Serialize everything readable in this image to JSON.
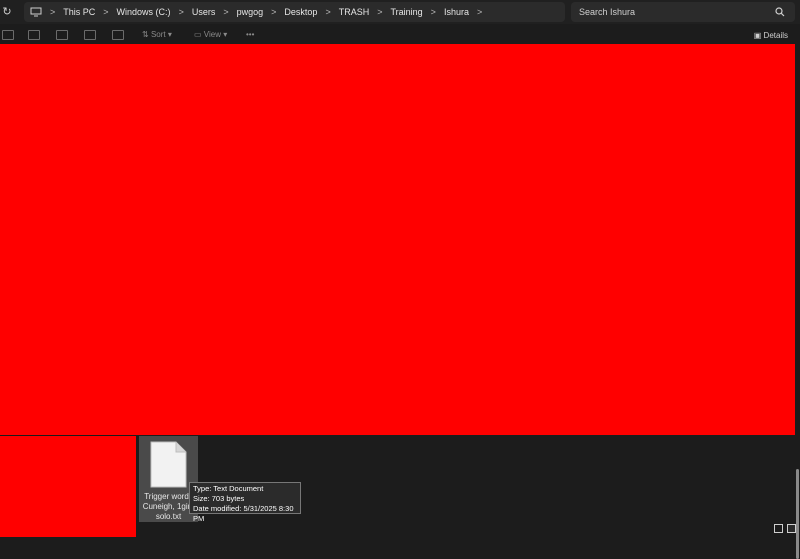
{
  "address_bar": {
    "refresh_icon": "refresh-icon",
    "crumbs": [
      "This PC",
      "Windows (C:)",
      "Users",
      "pwgog",
      "Desktop",
      "TRASH",
      "Training",
      "Ishura"
    ]
  },
  "search": {
    "placeholder": "Search Ishura",
    "icon": "search-icon"
  },
  "toolbar": {
    "sort_label": "Sort",
    "view_label": "View",
    "more_label": "•••",
    "details_label": "Details"
  },
  "file": {
    "name_line1": "Trigger words",
    "name_line2": "Cuneigh, 1girl,",
    "name_line3": "solo.txt"
  },
  "tooltip": {
    "type": "Type: Text Document",
    "size": "Size: 703 bytes",
    "modified": "Date modified: 5/31/2025 8:30 PM"
  },
  "colors": {
    "redaction": "#ff0000",
    "background": "#1c1c1c",
    "selection": "#4a4a4a"
  }
}
